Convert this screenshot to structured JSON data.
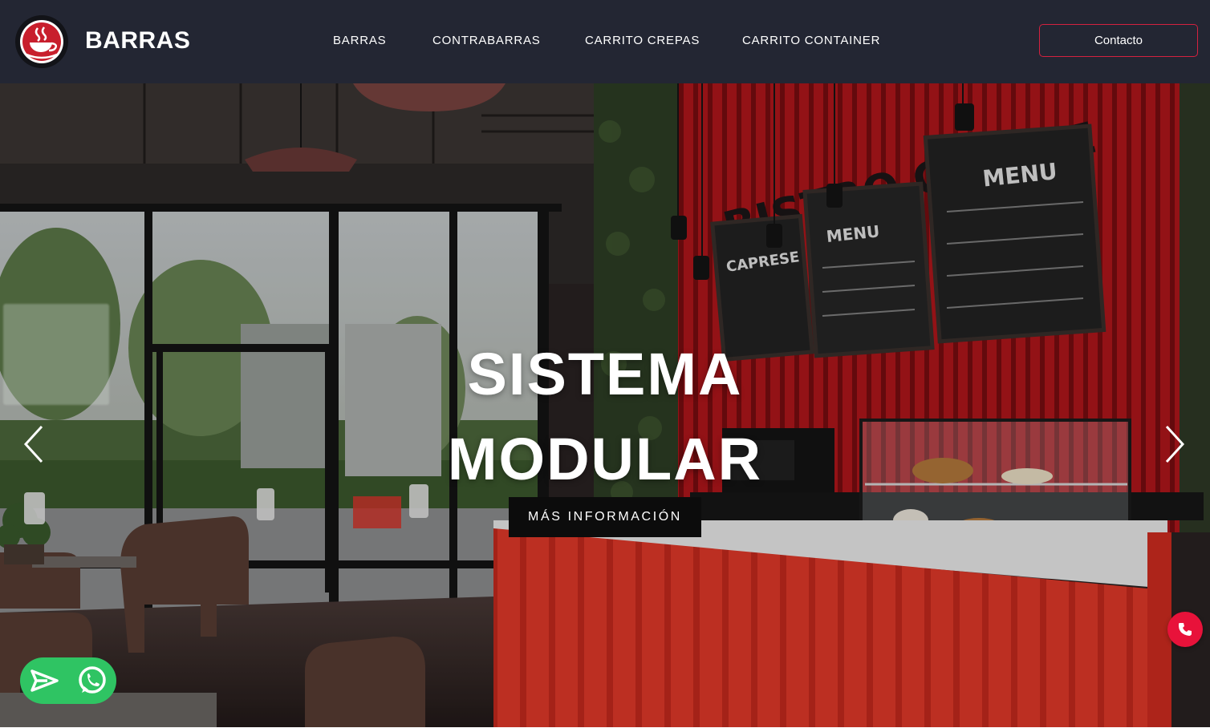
{
  "header": {
    "logo_icon": "coffee-cup-icon",
    "brand": "BARRAS",
    "nav": [
      "BARRAS",
      "CONTRABARRAS",
      "CARRITO CREPAS",
      "CARRITO CONTAINER"
    ],
    "contact_label": "Contacto"
  },
  "hero": {
    "title_line1": "SISTEMA",
    "title_line2": "MODULAR",
    "cta_label": "MÁS INFORMACIÓN",
    "prev_icon": "chevron-left-icon",
    "next_icon": "chevron-right-icon"
  },
  "floating": {
    "send_icon": "send-icon",
    "whatsapp_icon": "whatsapp-icon",
    "phone_icon": "phone-icon"
  },
  "colors": {
    "header_bg": "#232633",
    "accent_red": "#d4213f",
    "whatsapp_green": "#2fc463",
    "phone_red": "#e8123a"
  }
}
